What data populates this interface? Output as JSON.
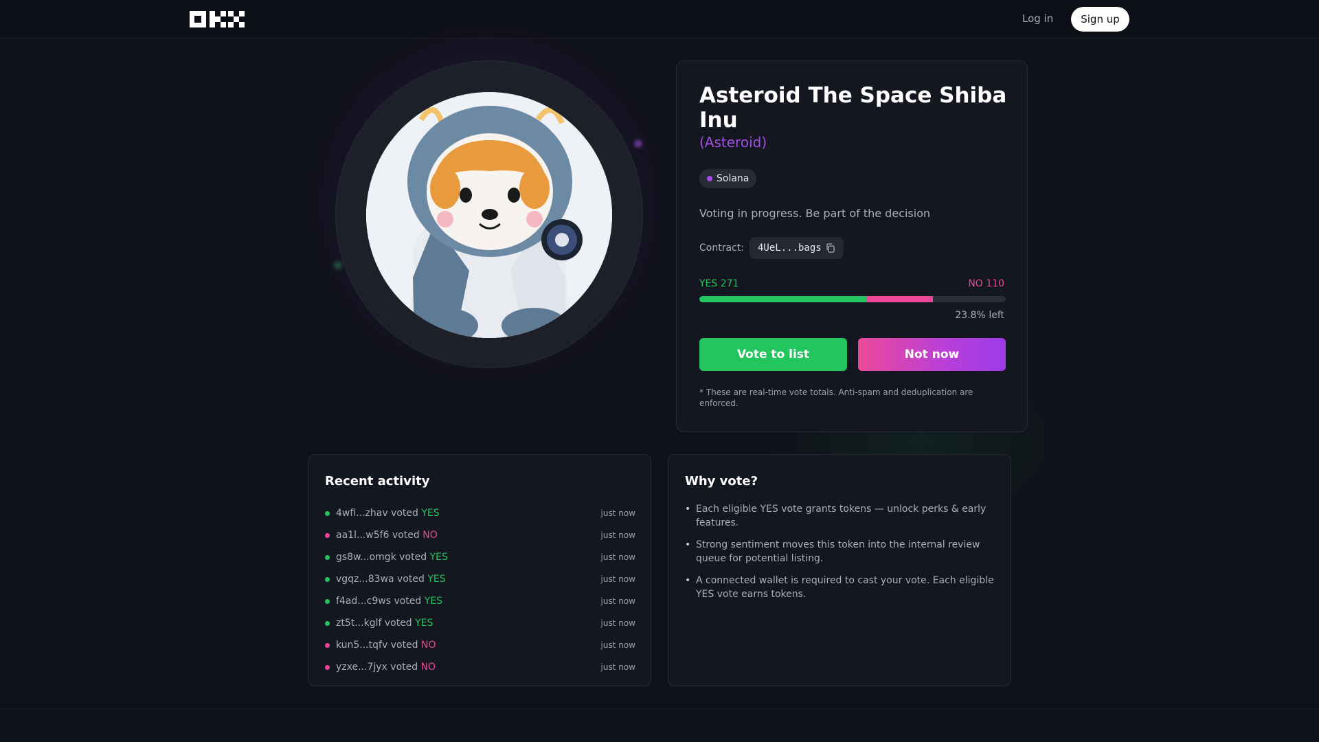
{
  "header": {
    "logo_alt": "OKX",
    "login_label": "Log in",
    "signup_label": "Sign up"
  },
  "token": {
    "name": "Asteroid The Space Shiba Inu",
    "symbol": "(Asteroid)",
    "chain": "Solana",
    "status": "Voting in progress. Be part of the decision",
    "contract_label": "Contract:",
    "contract_short": "4UeL...bags",
    "yes_label": "YES 271",
    "no_label": "NO 110",
    "yes_votes": 271,
    "no_votes": 110,
    "bar_yes_fraction": 0.544,
    "bar_no_fraction": 0.218,
    "time_left": "23.8% left",
    "vote_button": "Vote to list",
    "not_now_button": "Not now",
    "disclaimer": "* These are real-time vote totals. Anti-spam and deduplication are enforced."
  },
  "activity": {
    "title": "Recent activity",
    "items": [
      {
        "wallet": "4wfi...zhav",
        "vote": "YES",
        "time": "just now"
      },
      {
        "wallet": "aa1l...w5f6",
        "vote": "NO",
        "time": "just now"
      },
      {
        "wallet": "gs8w...omgk",
        "vote": "YES",
        "time": "just now"
      },
      {
        "wallet": "vgqz...83wa",
        "vote": "YES",
        "time": "just now"
      },
      {
        "wallet": "f4ad...c9ws",
        "vote": "YES",
        "time": "just now"
      },
      {
        "wallet": "zt5t...kglf",
        "vote": "YES",
        "time": "just now"
      },
      {
        "wallet": "kun5...tqfv",
        "vote": "NO",
        "time": "just now"
      },
      {
        "wallet": "yzxe...7jyx",
        "vote": "NO",
        "time": "just now"
      }
    ],
    "voted_word": "voted"
  },
  "why": {
    "title": "Why vote?",
    "items": [
      "Each eligible YES vote grants tokens — unlock perks & early features.",
      "Strong sentiment moves this token into the internal review queue for potential listing.",
      "A connected wallet is required to cast your vote. Each eligible YES vote earns tokens."
    ]
  },
  "colors": {
    "yes": "#22c55e",
    "no": "#ec4899",
    "accent": "#a24ee6",
    "background": "#0e1118"
  },
  "icons": {
    "copy": "copy-icon",
    "logo": "okx-logo",
    "avatar": "token-avatar-shiba-astronaut"
  }
}
